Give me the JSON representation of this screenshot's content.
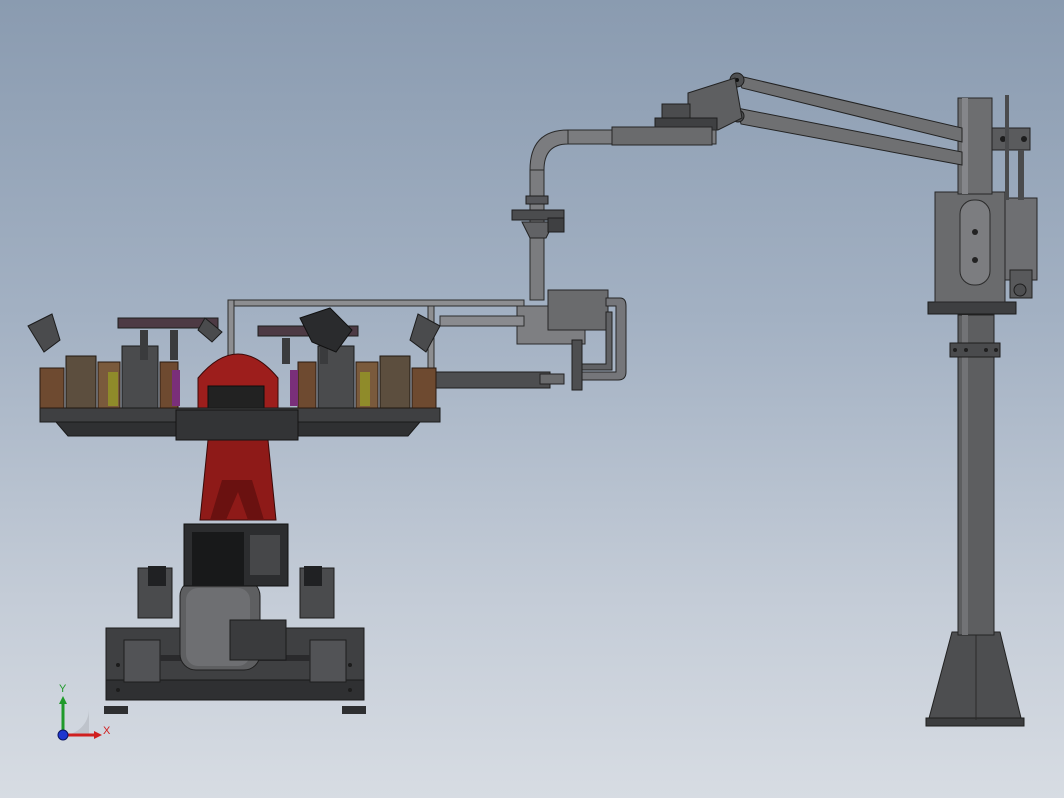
{
  "window": {
    "title": ""
  },
  "colors": {
    "background_top": "#8a9bb0",
    "background_bottom": "#d7dce3",
    "steel": "#5b5c5e",
    "steel_dark": "#3a3b3d",
    "steel_light": "#8c8d90",
    "rotator_red": "#8e1a18",
    "fixture_brown": "#6e4a30",
    "axis_x": "#d01f1f",
    "axis_y": "#1f9a2a",
    "axis_z": "#1f36d0"
  },
  "triad": {
    "x_label": "X",
    "y_label": "Y"
  },
  "model": {
    "assemblies": [
      "welding-fixture-rotator",
      "column-mounted-balance-arm"
    ]
  }
}
